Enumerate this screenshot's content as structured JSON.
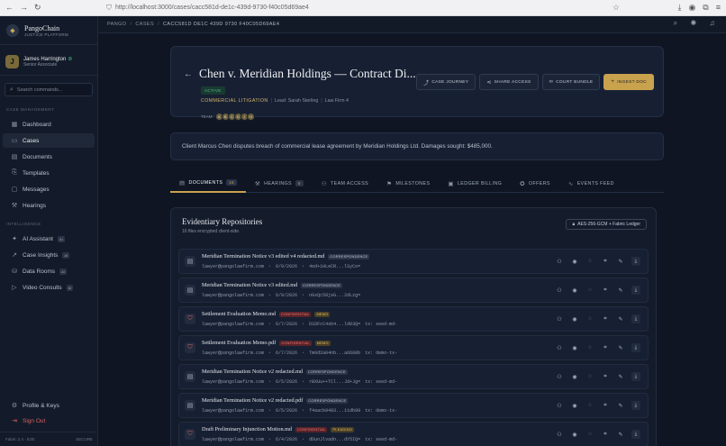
{
  "browser": {
    "url": "http://localhost:3000/cases/cacc581d-de1c-439d-9730-f40c05d69ae4"
  },
  "sidebar": {
    "brand_name": "PangoChain",
    "brand_sub": "JUSTICE PLATFORM",
    "user_name": "James Harrington",
    "user_role": "Senior Associate",
    "user_initial": "J",
    "search_placeholder": "Search commands...",
    "section_case": "CASE MANAGEMENT",
    "section_intel": "INTELLIGENCE",
    "items": [
      {
        "label": "Dashboard",
        "icon": "grid-icon"
      },
      {
        "label": "Cases",
        "icon": "folder-icon"
      },
      {
        "label": "Documents",
        "icon": "document-icon"
      },
      {
        "label": "Templates",
        "icon": "template-icon"
      },
      {
        "label": "Messages",
        "icon": "message-icon"
      },
      {
        "label": "Hearings",
        "icon": "gavel-icon"
      }
    ],
    "intel_items": [
      {
        "label": "AI Assistant",
        "badge": "AI"
      },
      {
        "label": "Case Insights",
        "badge": "AI"
      },
      {
        "label": "Data Rooms",
        "badge": "AI"
      },
      {
        "label": "Video Consults",
        "badge": "AI"
      }
    ],
    "profile_label": "Profile & Keys",
    "signout_label": "Sign Out",
    "footer_left": "Fabric 2.4 · E2E",
    "footer_right": "SECURE"
  },
  "topbar": {
    "crumbs": [
      "PANGO",
      "CASES",
      "CACC581D DE1C 439D 9730 F40C05D69AE4"
    ]
  },
  "case": {
    "title": "Chen v. Meridian Holdings — Contract Di...",
    "status": "ACTIVE",
    "type": "COMMERCIAL LITIGATION",
    "lead": "Lead: Sarah Sterling",
    "firm": "Law Firm 4",
    "team_label": "TEAM:",
    "team": [
      "A",
      "B",
      "C",
      "D",
      "J",
      "+1"
    ],
    "buttons": {
      "journey": "CASE JOURNEY",
      "share": "SHARE ACCESS",
      "bundle": "COURT BUNDLE",
      "ingest": "INGEST DOC"
    },
    "summary": "Client Marcus Chen disputes breach of commercial lease agreement by Meridian Holdings Ltd. Damages sought: $485,000."
  },
  "tabs": [
    {
      "label": "DOCUMENTS",
      "count": "16",
      "icon": "document-icon"
    },
    {
      "label": "HEARINGS",
      "count": "5",
      "icon": "gavel-icon"
    },
    {
      "label": "TEAM ACCESS",
      "count": "",
      "icon": "users-icon"
    },
    {
      "label": "MILESTONES",
      "count": "",
      "icon": "flag-icon"
    },
    {
      "label": "LEDGER BILLING",
      "count": "",
      "icon": "ledger-icon"
    },
    {
      "label": "OFFERS",
      "count": "",
      "icon": "offer-icon"
    },
    {
      "label": "EVENTS FEED",
      "count": "",
      "icon": "pulse-icon"
    }
  ],
  "repository": {
    "title": "Evidentiary Repositories",
    "subtitle": "16 files encrypted client-side.",
    "encryption": "AES-256-GCM + Fabric Ledger",
    "files": [
      {
        "name": "Meridian Termination Notice v3 edited v4 redacted.md",
        "tags": [
          {
            "text": "CORRESPONDENCE",
            "kind": "corr"
          }
        ],
        "owner": "lawyer@pangolawfirm.com",
        "date": "6/9/2026",
        "hash": "4ed+iHLeCR...lSyCo=",
        "tx": "",
        "conf": false
      },
      {
        "name": "Meridian Termination Notice v3 edited.md",
        "tags": [
          {
            "text": "CORRESPONDENCE",
            "kind": "corr"
          }
        ],
        "owner": "lawyer@pangolawfirm.com",
        "date": "6/9/2026",
        "hash": "nGxQc58jsG...2dLzg=",
        "tx": "",
        "conf": false
      },
      {
        "name": "Settlement Evaluation Memo.md",
        "tags": [
          {
            "text": "CONFIDENTIAL",
            "kind": "conf"
          },
          {
            "text": "MEMO",
            "kind": "memo"
          }
        ],
        "owner": "lawyer@pangolawfirm.com",
        "date": "6/7/2026",
        "hash": "D1DFcC4sb4...ld03Q=",
        "tx": "tx: seed-md-",
        "conf": true
      },
      {
        "name": "Settlement Evaluation Memo.pdf",
        "tags": [
          {
            "text": "CONFIDENTIAL",
            "kind": "conf"
          },
          {
            "text": "MEMO",
            "kind": "memo"
          }
        ],
        "owner": "lawyer@pangolawfirm.com",
        "date": "6/7/2026",
        "hash": "Tm0d2a04nb...a6680b",
        "tx": "tx: demo-tx-",
        "conf": true
      },
      {
        "name": "Meridian Termination Notice v2 redacted.md",
        "tags": [
          {
            "text": "CORRESPONDENCE",
            "kind": "corr"
          }
        ],
        "owner": "lawyer@pangolawfirm.com",
        "date": "6/5/2026",
        "hash": "rBXUu++TCl...Jd+Jg=",
        "tx": "tx: seed-md-",
        "conf": false
      },
      {
        "name": "Meridian Termination Notice v2 redacted.pdf",
        "tags": [
          {
            "text": "CORRESPONDENCE",
            "kind": "corr"
          }
        ],
        "owner": "lawyer@pangolawfirm.com",
        "date": "6/5/2026",
        "hash": "f4aacb9483...11db98",
        "tx": "tx: demo-tx-",
        "conf": false
      },
      {
        "name": "Draft Preliminary Injunction Motion.md",
        "tags": [
          {
            "text": "CONFIDENTIAL",
            "kind": "conf"
          },
          {
            "text": "PLEADING",
            "kind": "plead"
          }
        ],
        "owner": "lawyer@pangolawfirm.com",
        "date": "6/4/2026",
        "hash": "dDunJlvadn...dY5IQ=",
        "tx": "tx: seed-md-",
        "conf": true
      }
    ]
  }
}
